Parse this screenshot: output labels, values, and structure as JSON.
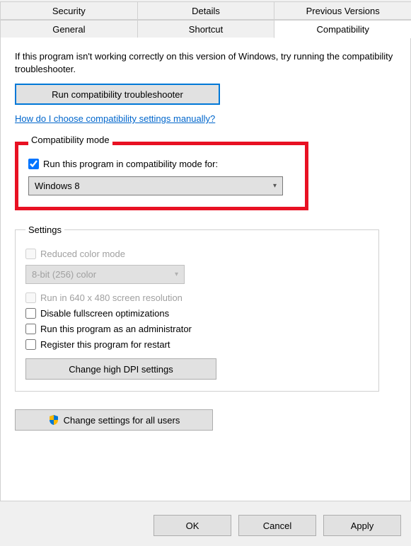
{
  "tabs": {
    "row1": [
      "Security",
      "Details",
      "Previous Versions"
    ],
    "row2": [
      "General",
      "Shortcut",
      "Compatibility"
    ],
    "active": "Compatibility"
  },
  "intro": "If this program isn't working correctly on this version of Windows, try running the compatibility troubleshooter.",
  "troubleshooter_btn": "Run compatibility troubleshooter",
  "help_link": "How do I choose compatibility settings manually?",
  "compat_mode": {
    "legend": "Compatibility mode",
    "checkbox_label": "Run this program in compatibility mode for:",
    "checked": true,
    "selected": "Windows 8"
  },
  "settings": {
    "legend": "Settings",
    "reduced_color": {
      "label": "Reduced color mode",
      "checked": false,
      "disabled": true
    },
    "color_select": {
      "value": "8-bit (256) color",
      "disabled": true
    },
    "run_640": {
      "label": "Run in 640 x 480 screen resolution",
      "checked": false,
      "disabled": true
    },
    "disable_fullscreen": {
      "label": "Disable fullscreen optimizations",
      "checked": false
    },
    "run_admin": {
      "label": "Run this program as an administrator",
      "checked": false
    },
    "register_restart": {
      "label": "Register this program for restart",
      "checked": false
    },
    "dpi_btn": "Change high DPI settings"
  },
  "all_users_btn": "Change settings for all users",
  "buttons": {
    "ok": "OK",
    "cancel": "Cancel",
    "apply": "Apply"
  }
}
